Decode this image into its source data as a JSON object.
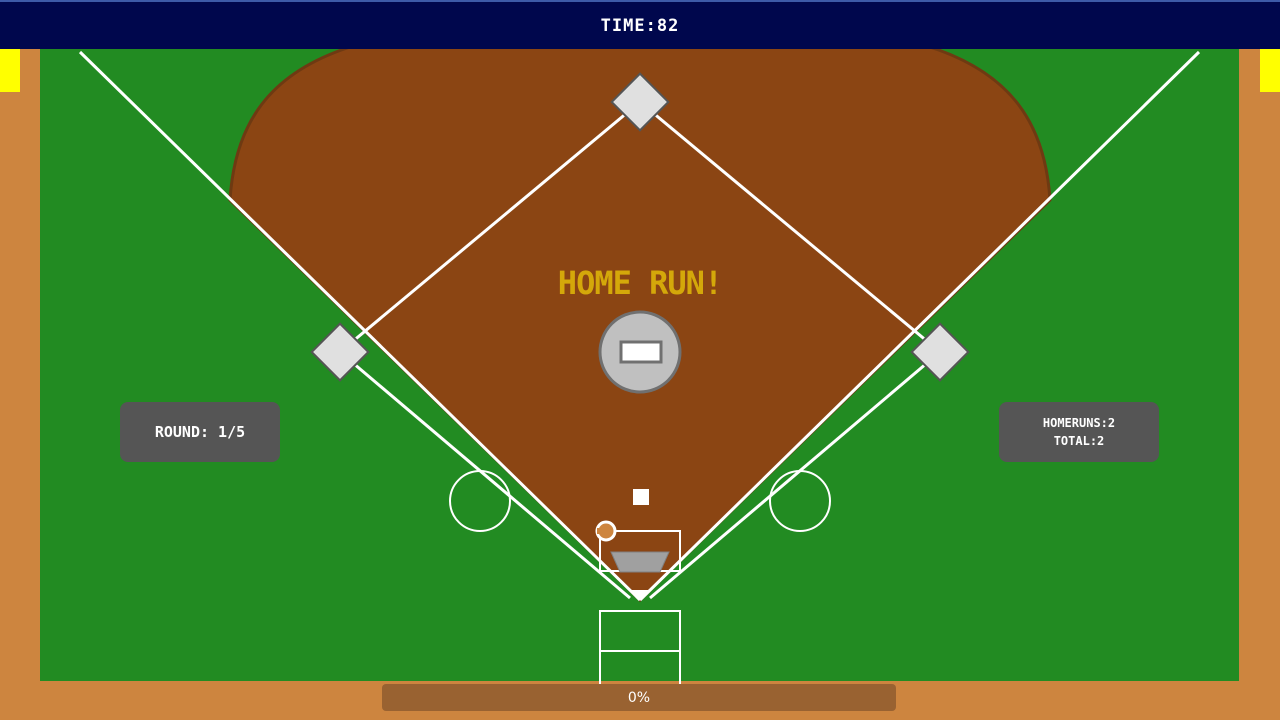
{
  "hud": {
    "timer_text": "TIME:82",
    "round_text": "ROUND: 1/5",
    "home_runs_text": "HOMERUNS:2",
    "total_text": "TOTAL:2",
    "banner_text": "HOME RUN!",
    "power_text": "0%",
    "power_level": 0
  },
  "colors": {
    "dirt_border": "#cd853f",
    "grass": "#228b22",
    "infield_dirt": "#8b4513",
    "top_bar": "#00074d",
    "marker": "#ffff00",
    "banner": "#d4a80a",
    "panel": "#555555",
    "base": "#e0e0e0"
  }
}
